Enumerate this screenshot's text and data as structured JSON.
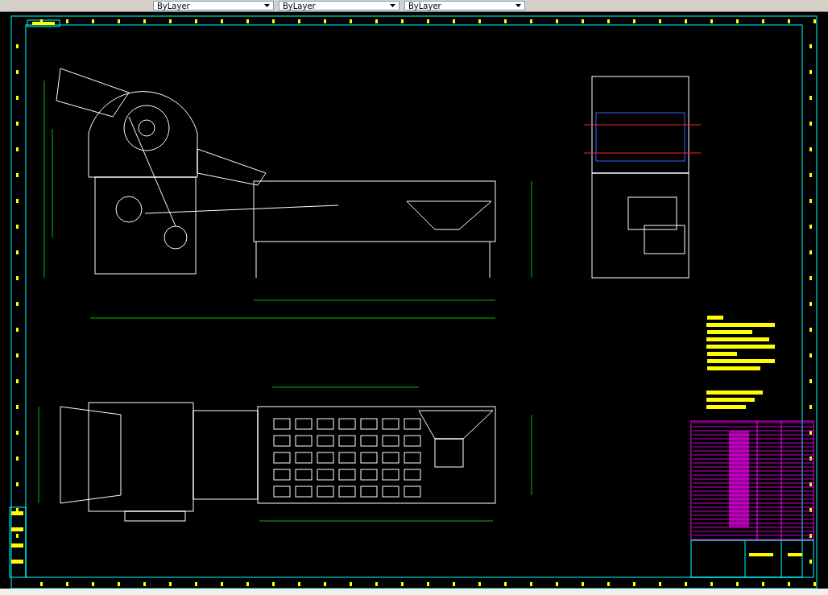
{
  "toolbar": {
    "dropdowns": [
      {
        "value": "ByLayer"
      },
      {
        "value": "ByLayer"
      },
      {
        "value": "ByLayer"
      }
    ]
  }
}
